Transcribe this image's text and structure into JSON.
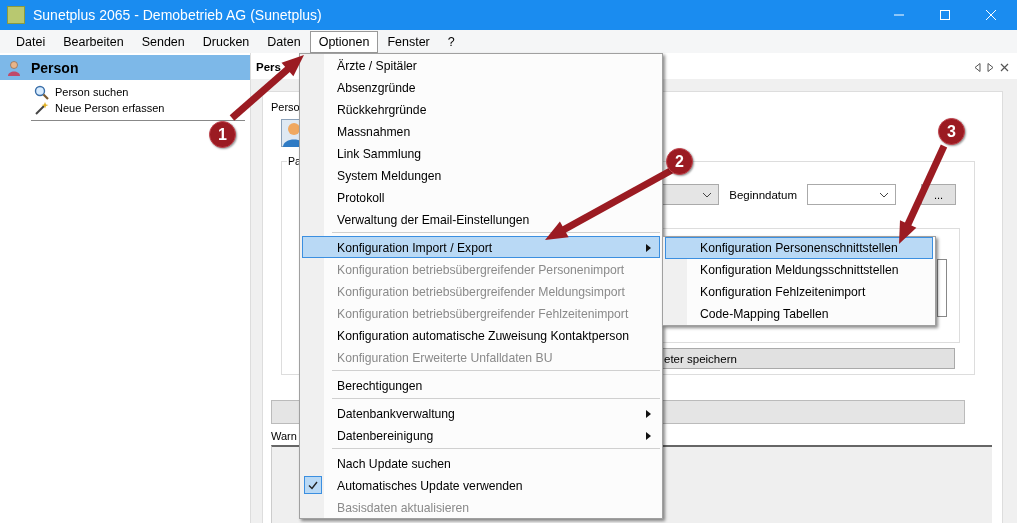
{
  "window": {
    "title": "Sunetplus 2065 - Demobetrieb AG (Sunetplus)"
  },
  "menubar": [
    {
      "label": "Datei",
      "selected": false
    },
    {
      "label": "Bearbeiten",
      "selected": false
    },
    {
      "label": "Senden",
      "selected": false
    },
    {
      "label": "Drucken",
      "selected": false
    },
    {
      "label": "Daten",
      "selected": false
    },
    {
      "label": "Optionen",
      "selected": true
    },
    {
      "label": "Fenster",
      "selected": false
    },
    {
      "label": "?",
      "selected": false
    }
  ],
  "sidebar": {
    "title": "Person",
    "items": [
      {
        "label": "Person suchen",
        "kind": "search"
      },
      {
        "label": "Neue Person erfassen",
        "kind": "new"
      }
    ]
  },
  "document": {
    "tab": "Pers",
    "section_label": "Perso",
    "group_label": "Pa",
    "date_label": "Beginndatum",
    "browse_button": "...",
    "save_button": "eter speichern",
    "warnings_label": "Warn"
  },
  "options_menu": [
    {
      "kind": "item",
      "label": "Ärzte / Spitäler",
      "selected": false,
      "disabled": false,
      "submenu": false,
      "checked": false
    },
    {
      "kind": "item",
      "label": "Absenzgründe",
      "selected": false,
      "disabled": false,
      "submenu": false,
      "checked": false
    },
    {
      "kind": "item",
      "label": "Rückkehrgründe",
      "selected": false,
      "disabled": false,
      "submenu": false,
      "checked": false
    },
    {
      "kind": "item",
      "label": "Massnahmen",
      "selected": false,
      "disabled": false,
      "submenu": false,
      "checked": false
    },
    {
      "kind": "item",
      "label": "Link Sammlung",
      "selected": false,
      "disabled": false,
      "submenu": false,
      "checked": false
    },
    {
      "kind": "item",
      "label": "System Meldungen",
      "selected": false,
      "disabled": false,
      "submenu": false,
      "checked": false
    },
    {
      "kind": "item",
      "label": "Protokoll",
      "selected": false,
      "disabled": false,
      "submenu": false,
      "checked": false
    },
    {
      "kind": "item",
      "label": "Verwaltung der Email-Einstellungen",
      "selected": false,
      "disabled": false,
      "submenu": false,
      "checked": false
    },
    {
      "kind": "separator"
    },
    {
      "kind": "item",
      "label": "Konfiguration Import / Export",
      "selected": true,
      "disabled": false,
      "submenu": true,
      "checked": false
    },
    {
      "kind": "item",
      "label": "Konfiguration betriebsübergreifender Personenimport",
      "selected": false,
      "disabled": true,
      "submenu": false,
      "checked": false
    },
    {
      "kind": "item",
      "label": "Konfiguration betriebsübergreifender Meldungsimport",
      "selected": false,
      "disabled": true,
      "submenu": false,
      "checked": false
    },
    {
      "kind": "item",
      "label": "Konfiguration betriebsübergreifender Fehlzeitenimport",
      "selected": false,
      "disabled": true,
      "submenu": false,
      "checked": false
    },
    {
      "kind": "item",
      "label": "Konfiguration automatische Zuweisung Kontaktperson",
      "selected": false,
      "disabled": false,
      "submenu": false,
      "checked": false
    },
    {
      "kind": "item",
      "label": "Konfiguration Erweiterte Unfalldaten BU",
      "selected": false,
      "disabled": true,
      "submenu": false,
      "checked": false
    },
    {
      "kind": "separator"
    },
    {
      "kind": "item",
      "label": "Berechtigungen",
      "selected": false,
      "disabled": false,
      "submenu": false,
      "checked": false
    },
    {
      "kind": "separator"
    },
    {
      "kind": "item",
      "label": "Datenbankverwaltung",
      "selected": false,
      "disabled": false,
      "submenu": true,
      "checked": false
    },
    {
      "kind": "item",
      "label": "Datenbereinigung",
      "selected": false,
      "disabled": false,
      "submenu": true,
      "checked": false
    },
    {
      "kind": "separator"
    },
    {
      "kind": "item",
      "label": "Nach Update suchen",
      "selected": false,
      "disabled": false,
      "submenu": false,
      "checked": false
    },
    {
      "kind": "item",
      "label": "Automatisches Update verwenden",
      "selected": false,
      "disabled": false,
      "submenu": false,
      "checked": true
    },
    {
      "kind": "item",
      "label": "Basisdaten aktualisieren",
      "selected": false,
      "disabled": true,
      "submenu": false,
      "checked": false
    }
  ],
  "import_export_submenu": [
    {
      "label": "Konfiguration Personenschnittstellen",
      "selected": true
    },
    {
      "label": "Konfiguration Meldungsschnittstellen",
      "selected": false
    },
    {
      "label": "Konfiguration Fehlzeitenimport",
      "selected": false
    },
    {
      "label": "Code-Mapping Tabellen",
      "selected": false
    }
  ],
  "annotations": [
    {
      "number": "1"
    },
    {
      "number": "2"
    },
    {
      "number": "3"
    }
  ]
}
